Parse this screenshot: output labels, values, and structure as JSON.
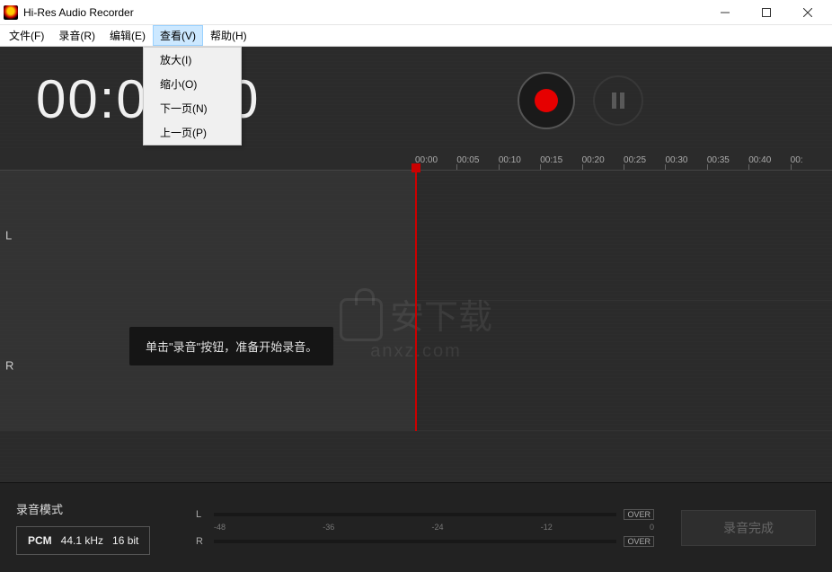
{
  "titlebar": {
    "title": "Hi-Res Audio Recorder"
  },
  "menubar": {
    "file": "文件(F)",
    "record": "录音(R)",
    "edit": "编辑(E)",
    "view": "查看(V)",
    "help": "帮助(H)"
  },
  "dropdown": {
    "zoom_in": "放大(I)",
    "zoom_out": "缩小(O)",
    "next_page": "下一页(N)",
    "prev_page": "上一页(P)"
  },
  "timer": "00:00:00",
  "ruler": [
    "00:00",
    "00:05",
    "00:10",
    "00:15",
    "00:20",
    "00:25",
    "00:30",
    "00:35",
    "00:40",
    "00:"
  ],
  "channels": {
    "left": "L",
    "right": "R"
  },
  "tooltip": "单击\"录音\"按钮，准备开始录音。",
  "watermark": {
    "main": "安下载",
    "sub": "anxz.com"
  },
  "bottom": {
    "mode_label": "录音模式",
    "codec": "PCM",
    "sample_rate": "44.1 kHz",
    "bit_depth": "16 bit",
    "meter_scale": [
      "-48",
      "-36",
      "-24",
      "-12",
      "0"
    ],
    "over": "OVER",
    "finish": "录音完成"
  }
}
